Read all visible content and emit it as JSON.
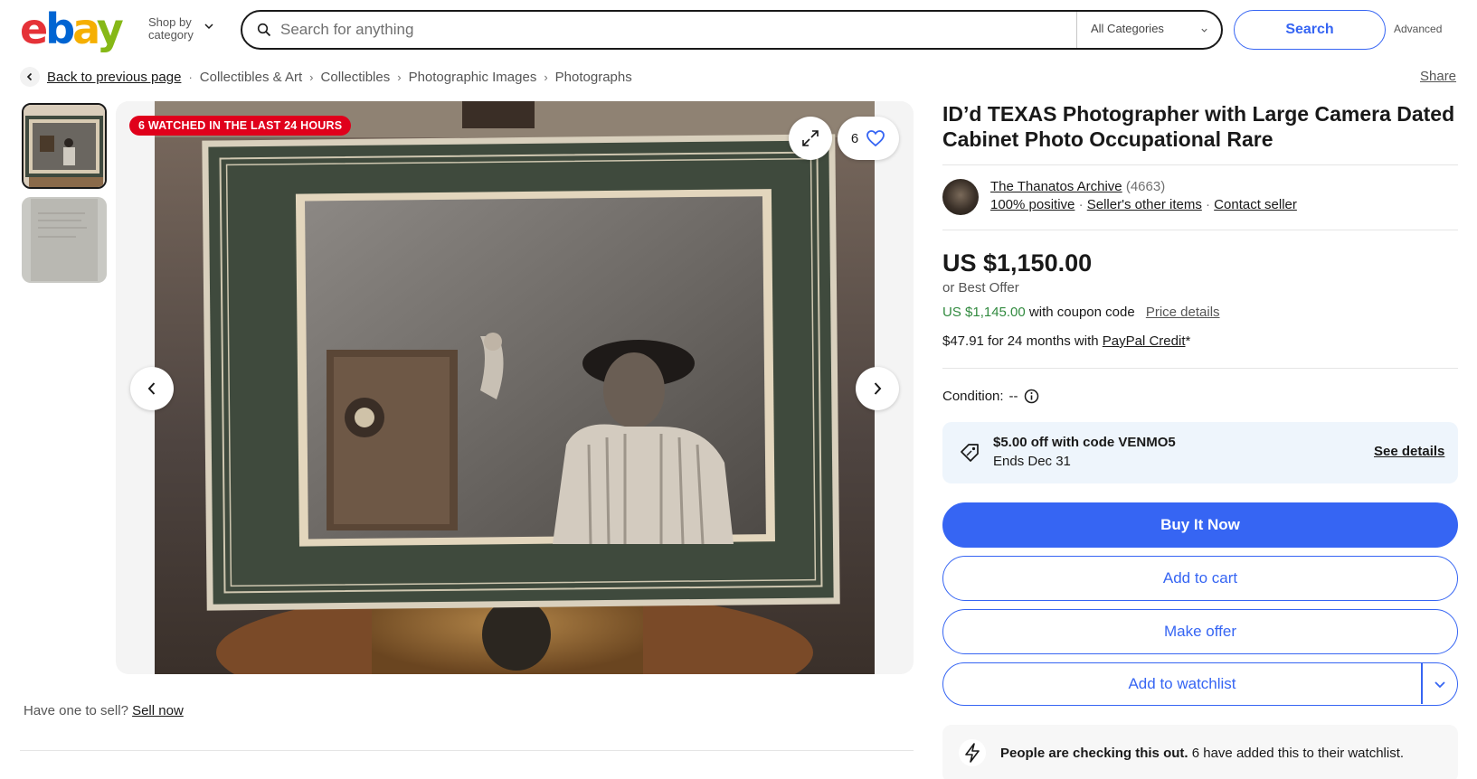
{
  "header": {
    "logo": {
      "e": "e",
      "b": "b",
      "a": "a",
      "y": "y"
    },
    "shop_by_line1": "Shop by",
    "shop_by_line2": "category",
    "search_placeholder": "Search for anything",
    "category": "All Categories",
    "search_button": "Search",
    "advanced": "Advanced"
  },
  "breadcrumb": {
    "back": "Back to previous page",
    "items": [
      "Collectibles & Art",
      "Collectibles",
      "Photographic Images",
      "Photographs"
    ],
    "share": "Share"
  },
  "gallery": {
    "watched_badge": "6 WATCHED IN THE LAST 24 HOURS",
    "watch_count": "6"
  },
  "sell": {
    "prefix": "Have one to sell?",
    "link": "Sell now"
  },
  "listing": {
    "title": "ID’d TEXAS Photographer with Large Camera Dated Cabinet Photo Occupational Rare",
    "seller": {
      "name": "The Thanatos Archive",
      "feedback_count": "(4663)",
      "positive": "100% positive",
      "other_items": "Seller's other items",
      "contact": "Contact seller"
    },
    "price": "US $1,150.00",
    "best_offer": "or Best Offer",
    "coupon_price": "US $1,145.00",
    "coupon_text": "with coupon code",
    "price_details": "Price details",
    "credit_text": "$47.91 for 24 months with",
    "credit_link": "PayPal Credit",
    "credit_suffix": "*",
    "condition_label": "Condition:",
    "condition_value": "--",
    "promo": {
      "title": "$5.00 off with code VENMO5",
      "subtitle": "Ends Dec 31",
      "link": "See details"
    },
    "buttons": {
      "buy": "Buy It Now",
      "cart": "Add to cart",
      "offer": "Make offer",
      "watchlist": "Add to watchlist"
    },
    "people": {
      "bold": "People are checking this out.",
      "rest": "6 have added this to their watchlist."
    }
  },
  "colors": {
    "accent": "#3665f3",
    "badge": "#e0001b",
    "green": "#318a3f",
    "promo_bg": "#eef5fc"
  },
  "icons": [
    "search-icon",
    "chevron-down-icon",
    "chevron-left-icon",
    "expand-icon",
    "heart-icon",
    "chevron-right-icon",
    "info-icon",
    "tag-icon",
    "lightning-icon"
  ]
}
